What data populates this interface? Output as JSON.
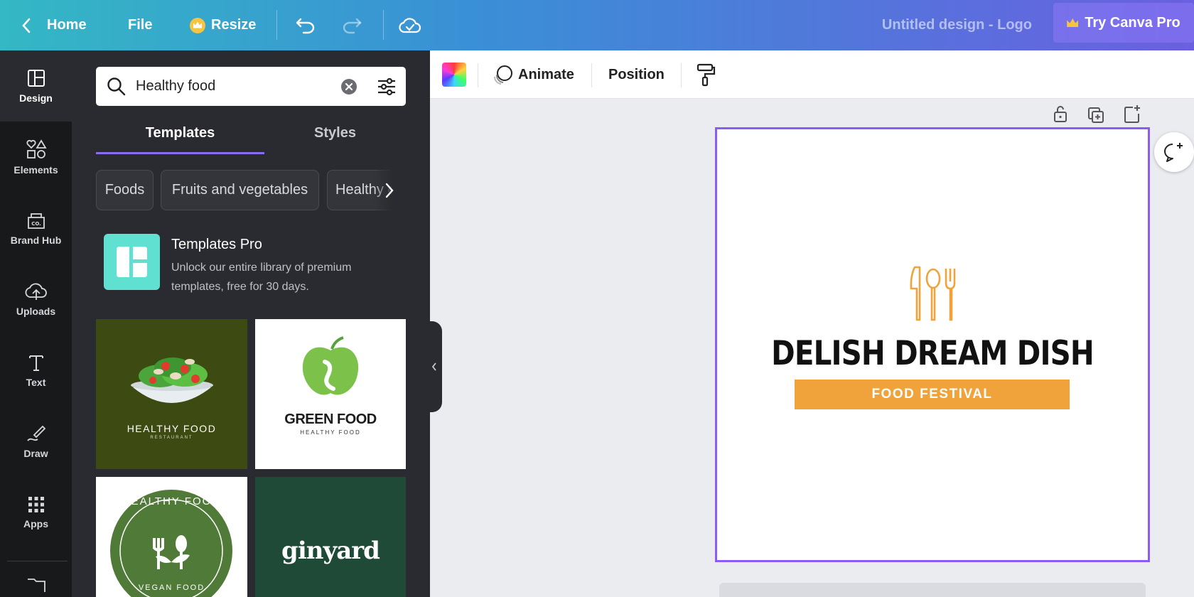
{
  "topbar": {
    "home": "Home",
    "file": "File",
    "resize": "Resize",
    "design_title": "Untitled design - Logo",
    "try_pro": "Try Canva Pro"
  },
  "rail": {
    "items": [
      {
        "label": "Design",
        "icon": "layout-icon"
      },
      {
        "label": "Elements",
        "icon": "shapes-icon"
      },
      {
        "label": "Brand Hub",
        "icon": "brand-icon"
      },
      {
        "label": "Uploads",
        "icon": "cloud-upload-icon"
      },
      {
        "label": "Text",
        "icon": "text-icon"
      },
      {
        "label": "Draw",
        "icon": "draw-icon"
      },
      {
        "label": "Apps",
        "icon": "apps-grid-icon"
      }
    ]
  },
  "panel": {
    "search": {
      "value": "Healthy food"
    },
    "tabs": [
      "Templates",
      "Styles"
    ],
    "chips": [
      "Foods",
      "Fruits and vegetables",
      "Healthy e"
    ],
    "promo": {
      "title": "Templates Pro",
      "desc": "Unlock our entire library of premium templates, free for 30 days."
    },
    "thumbs": [
      {
        "title": "HEALTHY FOOD",
        "subtitle": "RESTAURANT",
        "bg": "#3d4a12"
      },
      {
        "title": "GREEN FOOD",
        "subtitle": "HEALTHY FOOD",
        "bg": "#ffffff"
      },
      {
        "title": "HEALTHY FOOD",
        "subtitle": "VEGAN FOOD",
        "bg": "#ffffff"
      },
      {
        "title": "ginyard",
        "subtitle": "",
        "bg": "#1f4a38"
      }
    ]
  },
  "toolbar": {
    "animate": "Animate",
    "position": "Position"
  },
  "canvas": {
    "logo_title": "DELISH DREAM DISH",
    "logo_band": "FOOD FESTIVAL",
    "accent": "#f0a33a",
    "selection": "#8a5cf5"
  }
}
